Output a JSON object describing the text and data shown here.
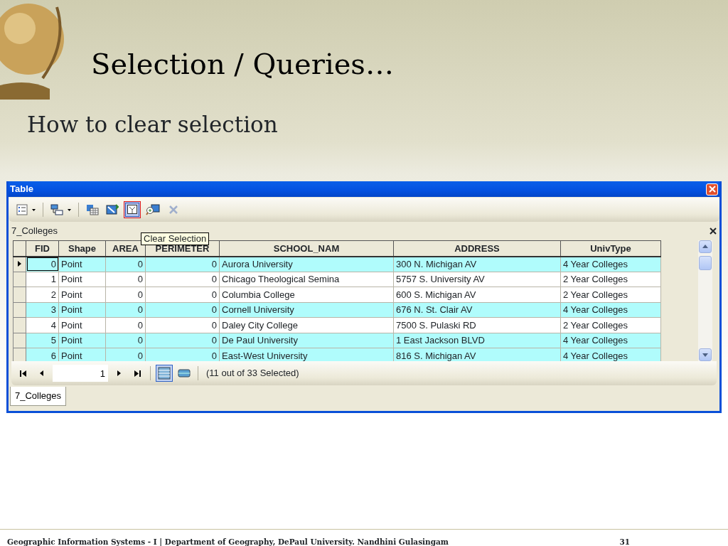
{
  "slide": {
    "title": "Selection / Queries…",
    "subtitle": "How to clear selection"
  },
  "window": {
    "title": "Table"
  },
  "toolbar": [
    {
      "kind": "options",
      "dropdown": true,
      "highlighted": false,
      "disabled": false
    },
    {
      "kind": "related",
      "dropdown": true,
      "highlighted": false,
      "disabled": false
    },
    {
      "kind": "select",
      "highlighted": false,
      "disabled": false
    },
    {
      "kind": "switch",
      "highlighted": false,
      "disabled": false
    },
    {
      "kind": "clear",
      "highlighted": true,
      "disabled": false
    },
    {
      "kind": "zoom",
      "highlighted": false,
      "disabled": false
    },
    {
      "kind": "delete",
      "highlighted": false,
      "disabled": true
    }
  ],
  "tooltip": "Clear Selection",
  "table_name": "7_Colleges",
  "columns": [
    {
      "label": "FID",
      "kind": "number"
    },
    {
      "label": "Shape",
      "kind": "text"
    },
    {
      "label": "AREA",
      "kind": "number"
    },
    {
      "label": "PERIMETER",
      "kind": "number"
    },
    {
      "label": "SCHOOL_NAM",
      "kind": "text"
    },
    {
      "label": "ADDRESS",
      "kind": "text"
    },
    {
      "label": "UnivType",
      "kind": "text"
    }
  ],
  "rows": [
    {
      "cells": [
        "0",
        "Point",
        "0",
        "0",
        "Aurora University",
        "300 N. Michigan AV",
        "4 Year Colleges"
      ],
      "selected": true,
      "current": true
    },
    {
      "cells": [
        "1",
        "Point",
        "0",
        "0",
        "Chicago Theological Semina",
        "5757 S. University AV",
        "2 Year Colleges"
      ],
      "selected": false,
      "current": false
    },
    {
      "cells": [
        "2",
        "Point",
        "0",
        "0",
        "Columbia College",
        "600 S. Michigan AV",
        "2 Year Colleges"
      ],
      "selected": false,
      "current": false
    },
    {
      "cells": [
        "3",
        "Point",
        "0",
        "0",
        "Cornell University",
        "676 N. St. Clair AV",
        "4 Year Colleges"
      ],
      "selected": true,
      "current": false
    },
    {
      "cells": [
        "4",
        "Point",
        "0",
        "0",
        "Daley City College",
        "7500 S. Pulaski RD",
        "2 Year Colleges"
      ],
      "selected": false,
      "current": false
    },
    {
      "cells": [
        "5",
        "Point",
        "0",
        "0",
        "De Paul University",
        "1 East Jackson BLVD",
        "4 Year Colleges"
      ],
      "selected": true,
      "current": false
    },
    {
      "cells": [
        "6",
        "Point",
        "0",
        "0",
        "East-West University",
        "816 S. Michigan AV",
        "4 Year Colleges"
      ],
      "selected": true,
      "current": false
    }
  ],
  "pager": {
    "record": "1",
    "status": "(11 out of 33 Selected)",
    "views": [
      {
        "selected": true
      },
      {
        "selected": false
      }
    ]
  },
  "tabs": [
    {
      "label": "7_Colleges",
      "selected": true
    }
  ],
  "footer": {
    "text": "Geographic Information Systems - I | Department of Geography, DePaul University. Nandhini Gulasingam",
    "page": "31"
  }
}
